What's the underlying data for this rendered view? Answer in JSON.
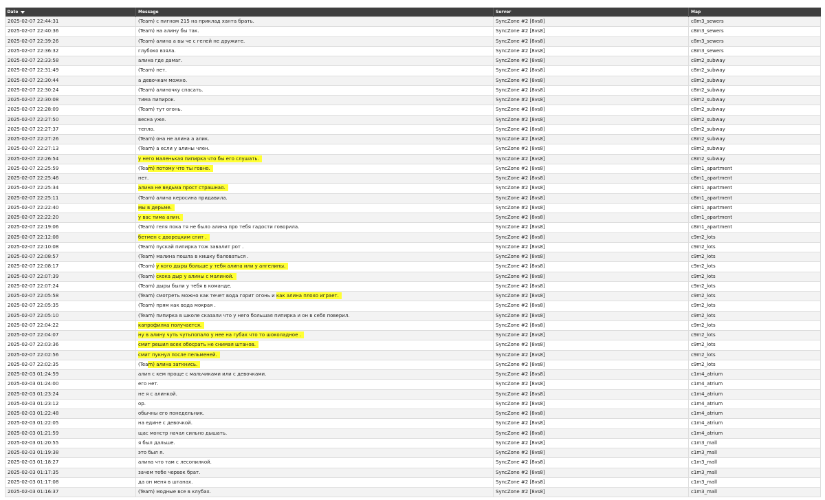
{
  "columns": {
    "date": "Date",
    "message": "Message",
    "server": "Server",
    "map": "Map"
  },
  "sort_icon": "sort-desc-icon",
  "highlight_color": "#ffff33",
  "rows": [
    {
      "date": "2025-02-07 22:44:31",
      "pre": "(Team) с пигном 215 на приклад ханта брать.",
      "hl": "",
      "post": "",
      "server": "SyncZone #2 [8vs8]",
      "map": "c8m3_sewers"
    },
    {
      "date": "2025-02-07 22:40:36",
      "pre": "(Team) на алину бы так.",
      "hl": "",
      "post": "",
      "server": "SyncZone #2 [8vs8]",
      "map": "c8m3_sewers"
    },
    {
      "date": "2025-02-07 22:39:26",
      "pre": "(Team) алина а вы че с гелей не дружите.",
      "hl": "",
      "post": "",
      "server": "SyncZone #2 [8vs8]",
      "map": "c8m3_sewers"
    },
    {
      "date": "2025-02-07 22:36:32",
      "pre": "глубоко взяла.",
      "hl": "",
      "post": "",
      "server": "SyncZone #2 [8vs8]",
      "map": "c8m3_sewers"
    },
    {
      "date": "2025-02-07 22:33:58",
      "pre": "алина где дамаг.",
      "hl": "",
      "post": "",
      "server": "SyncZone #2 [8vs8]",
      "map": "c8m2_subway"
    },
    {
      "date": "2025-02-07 22:31:49",
      "pre": "(Team) нет.",
      "hl": "",
      "post": "",
      "server": "SyncZone #2 [8vs8]",
      "map": "c8m2_subway"
    },
    {
      "date": "2025-02-07 22:30:44",
      "pre": "а девочкам можно.",
      "hl": "",
      "post": "",
      "server": "SyncZone #2 [8vs8]",
      "map": "c8m2_subway"
    },
    {
      "date": "2025-02-07 22:30:24",
      "pre": "(Team) алиночку спасать.",
      "hl": "",
      "post": "",
      "server": "SyncZone #2 [8vs8]",
      "map": "c8m2_subway"
    },
    {
      "date": "2025-02-07 22:30:08",
      "pre": "тима пипирок.",
      "hl": "",
      "post": "",
      "server": "SyncZone #2 [8vs8]",
      "map": "c8m2_subway"
    },
    {
      "date": "2025-02-07 22:28:09",
      "pre": "(Team) тут огонь.",
      "hl": "",
      "post": "",
      "server": "SyncZone #2 [8vs8]",
      "map": "c8m2_subway"
    },
    {
      "date": "2025-02-07 22:27:50",
      "pre": "весна уже.",
      "hl": "",
      "post": "",
      "server": "SyncZone #2 [8vs8]",
      "map": "c8m2_subway"
    },
    {
      "date": "2025-02-07 22:27:37",
      "pre": "тепло.",
      "hl": "",
      "post": "",
      "server": "SyncZone #2 [8vs8]",
      "map": "c8m2_subway"
    },
    {
      "date": "2025-02-07 22:27:26",
      "pre": "(Team) она не алина а алик.",
      "hl": "",
      "post": "",
      "server": "SyncZone #2 [8vs8]",
      "map": "c8m2_subway"
    },
    {
      "date": "2025-02-07 22:27:13",
      "pre": "(Team) а если у алины член.",
      "hl": "",
      "post": "",
      "server": "SyncZone #2 [8vs8]",
      "map": "c8m2_subway"
    },
    {
      "date": "2025-02-07 22:26:54",
      "pre": "",
      "hl": "у него маленькая пипирка что бы его слушать.",
      "post": "",
      "server": "SyncZone #2 [8vs8]",
      "map": "c8m2_subway"
    },
    {
      "date": "2025-02-07 22:25:59",
      "pre": "(Tea",
      "hl": "m) потому что ты говно.",
      "post": "",
      "server": "SyncZone #2 [8vs8]",
      "map": "c8m1_apartment"
    },
    {
      "date": "2025-02-07 22:25:46",
      "pre": "нет.",
      "hl": "",
      "post": "",
      "server": "SyncZone #2 [8vs8]",
      "map": "c8m1_apartment"
    },
    {
      "date": "2025-02-07 22:25:34",
      "pre": "",
      "hl": "алина не ведьма прост страшная.",
      "post": "",
      "server": "SyncZone #2 [8vs8]",
      "map": "c8m1_apartment"
    },
    {
      "date": "2025-02-07 22:25:11",
      "pre": "(Team) алина керосина придавила.",
      "hl": "",
      "post": "",
      "server": "SyncZone #2 [8vs8]",
      "map": "c8m1_apartment"
    },
    {
      "date": "2025-02-07 22:22:40",
      "pre": "",
      "hl": "мы в дерьме.",
      "post": "",
      "server": "SyncZone #2 [8vs8]",
      "map": "c8m1_apartment"
    },
    {
      "date": "2025-02-07 22:22:20",
      "pre": "",
      "hl": "у вас тима алин.",
      "post": "",
      "server": "SyncZone #2 [8vs8]",
      "map": "c8m1_apartment"
    },
    {
      "date": "2025-02-07 22:19:06",
      "pre": "(Team) геля пока тя не было алина про тебя гадости говорила.",
      "hl": "",
      "post": "",
      "server": "SyncZone #2 [8vs8]",
      "map": "c8m1_apartment"
    },
    {
      "date": "2025-02-07 22:12:08",
      "pre": "",
      "hl": "бетмен с дворецким спит .",
      "post": "",
      "server": "SyncZone #2 [8vs8]",
      "map": "c9m2_lots"
    },
    {
      "date": "2025-02-07 22:10:08",
      "pre": "(Team) пускай пипирка тож завалит рот .",
      "hl": "",
      "post": "",
      "server": "SyncZone #2 [8vs8]",
      "map": "c9m2_lots"
    },
    {
      "date": "2025-02-07 22:08:57",
      "pre": "(Team) малина пошла в кишку баловаться .",
      "hl": "",
      "post": "",
      "server": "SyncZone #2 [8vs8]",
      "map": "c9m2_lots"
    },
    {
      "date": "2025-02-07 22:08:17",
      "pre": "(Team) ",
      "hl": "у кого дыры больше у тебя алина или у ангелины.",
      "post": "",
      "server": "SyncZone #2 [8vs8]",
      "map": "c9m2_lots"
    },
    {
      "date": "2025-02-07 22:07:39",
      "pre": "(Team) ",
      "hl": "скока дыр у алины с малиной.",
      "post": "",
      "server": "SyncZone #2 [8vs8]",
      "map": "c9m2_lots"
    },
    {
      "date": "2025-02-07 22:07:24",
      "pre": "(Team) дыры были у тебя в команде.",
      "hl": "",
      "post": "",
      "server": "SyncZone #2 [8vs8]",
      "map": "c9m2_lots"
    },
    {
      "date": "2025-02-07 22:05:58",
      "pre": "(Team) смотреть можно как течет вода горит огонь и ",
      "hl": "как алина плохо играет.",
      "post": "",
      "server": "SyncZone #2 [8vs8]",
      "map": "c9m2_lots"
    },
    {
      "date": "2025-02-07 22:05:35",
      "pre": "(Team) прям как вода мокрая .",
      "hl": "",
      "post": "",
      "server": "SyncZone #2 [8vs8]",
      "map": "c9m2_lots"
    },
    {
      "date": "2025-02-07 22:05:10",
      "pre": "(Team) пипирка в школе сказали что у него большая пипирка и он в себя поверил.",
      "hl": "",
      "post": "",
      "server": "SyncZone #2 [8vs8]",
      "map": "c9m2_lots"
    },
    {
      "date": "2025-02-07 22:04:22",
      "pre": "",
      "hl": "капрофилка получается.",
      "post": "",
      "server": "SyncZone #2 [8vs8]",
      "map": "c9m2_lots"
    },
    {
      "date": "2025-02-07 22:04:07",
      "pre": "",
      "hl": "ну в алину чуть чутьпопало у нее на губах что то шоколадное .",
      "post": "",
      "server": "SyncZone #2 [8vs8]",
      "map": "c9m2_lots"
    },
    {
      "date": "2025-02-07 22:03:36",
      "pre": "",
      "hl": "смит решил всех обосрать не снимая штанов.",
      "post": "",
      "server": "SyncZone #2 [8vs8]",
      "map": "c9m2_lots"
    },
    {
      "date": "2025-02-07 22:02:56",
      "pre": "",
      "hl": "смит пукнул после пельменей.",
      "post": "",
      "server": "SyncZone #2 [8vs8]",
      "map": "c9m2_lots"
    },
    {
      "date": "2025-02-07 22:02:35",
      "pre": "(Tea",
      "hl": "m) алина заткнись.",
      "post": "",
      "server": "SyncZone #2 [8vs8]",
      "map": "c9m2_lots"
    },
    {
      "date": "2025-02-03 01:24:59",
      "pre": "алин с кем проще с мальчиками или с девочками.",
      "hl": "",
      "post": "",
      "server": "SyncZone #2 [8vs8]",
      "map": "c1m4_atrium"
    },
    {
      "date": "2025-02-03 01:24:00",
      "pre": "его нет.",
      "hl": "",
      "post": "",
      "server": "SyncZone #2 [8vs8]",
      "map": "c1m4_atrium"
    },
    {
      "date": "2025-02-03 01:23:24",
      "pre": "не я с алинкой.",
      "hl": "",
      "post": "",
      "server": "SyncZone #2 [8vs8]",
      "map": "c1m4_atrium"
    },
    {
      "date": "2025-02-03 01:23:12",
      "pre": "ор.",
      "hl": "",
      "post": "",
      "server": "SyncZone #2 [8vs8]",
      "map": "c1m4_atrium"
    },
    {
      "date": "2025-02-03 01:22:48",
      "pre": "обычны его понедельник.",
      "hl": "",
      "post": "",
      "server": "SyncZone #2 [8vs8]",
      "map": "c1m4_atrium"
    },
    {
      "date": "2025-02-03 01:22:05",
      "pre": "на едине с девочкой.",
      "hl": "",
      "post": "",
      "server": "SyncZone #2 [8vs8]",
      "map": "c1m4_atrium"
    },
    {
      "date": "2025-02-03 01:21:59",
      "pre": "щас монстр начал сильно дышать.",
      "hl": "",
      "post": "",
      "server": "SyncZone #2 [8vs8]",
      "map": "c1m4_atrium"
    },
    {
      "date": "2025-02-03 01:20:55",
      "pre": "я был дальше.",
      "hl": "",
      "post": "",
      "server": "SyncZone #2 [8vs8]",
      "map": "c1m3_mall"
    },
    {
      "date": "2025-02-03 01:19:38",
      "pre": "это был я.",
      "hl": "",
      "post": "",
      "server": "SyncZone #2 [8vs8]",
      "map": "c1m3_mall"
    },
    {
      "date": "2025-02-03 01:18:27",
      "pre": "алина что там с лесопилкой.",
      "hl": "",
      "post": "",
      "server": "SyncZone #2 [8vs8]",
      "map": "c1m3_mall"
    },
    {
      "date": "2025-02-03 01:17:35",
      "pre": "зачем тебе червок брат.",
      "hl": "",
      "post": "",
      "server": "SyncZone #2 [8vs8]",
      "map": "c1m3_mall"
    },
    {
      "date": "2025-02-03 01:17:08",
      "pre": "да он меня в штанах.",
      "hl": "",
      "post": "",
      "server": "SyncZone #2 [8vs8]",
      "map": "c1m3_mall"
    },
    {
      "date": "2025-02-03 01:16:37",
      "pre": "(Team) модные все в клубах.",
      "hl": "",
      "post": "",
      "server": "SyncZone #2 [8vs8]",
      "map": "c1m3_mall"
    }
  ]
}
